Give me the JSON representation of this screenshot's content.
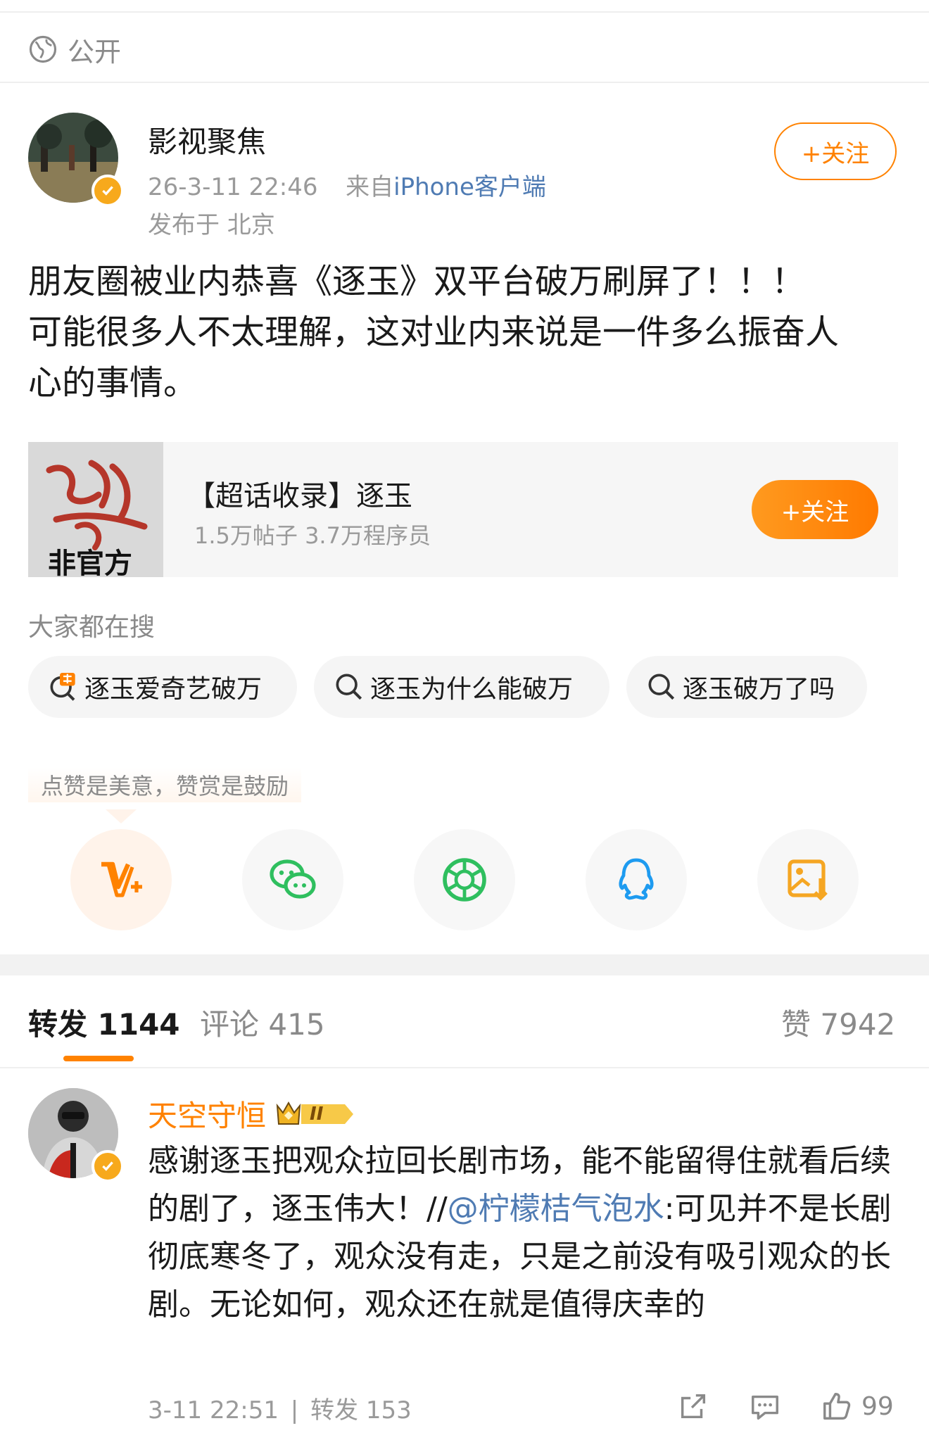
{
  "visibility": {
    "icon": "globe-icon",
    "label": "公开"
  },
  "post": {
    "author": "影视聚焦",
    "time": "26-3-11 22:46",
    "source_prefix": "来自",
    "source": "iPhone客户端",
    "location": "发布于 北京",
    "follow_label": "+关注",
    "text_lines": [
      "朋友圈被业内恭喜《逐玉》双平台破万刷屏了！！！",
      "可能很多人不太理解，这对业内来说是一件多么振奋人",
      "心的事情。"
    ]
  },
  "topic_card": {
    "thumb_text": "非官方",
    "title": "【超话收录】逐玉",
    "stats": "1.5万帖子 3.7万程序员",
    "follow_label": "+关注"
  },
  "search": {
    "heading": "大家都在搜",
    "chips": [
      {
        "label": "逐玉爱奇艺破万",
        "icon": "hot-search-icon"
      },
      {
        "label": "逐玉为什么能破万",
        "icon": "search-icon"
      },
      {
        "label": "逐玉破万了吗",
        "icon": "search-icon"
      }
    ]
  },
  "share": {
    "tip": "点赞是美意，赞赏是鼓励",
    "buttons": [
      {
        "icon": "v-plus-icon"
      },
      {
        "icon": "wechat-icon"
      },
      {
        "icon": "moments-icon"
      },
      {
        "icon": "qq-icon"
      },
      {
        "icon": "save-image-icon"
      }
    ]
  },
  "tabs": {
    "repost_label": "转发",
    "repost_count": "1144",
    "comment_label": "评论",
    "comment_count": "415",
    "like_label": "赞",
    "like_count": "7942"
  },
  "comment": {
    "user": "天空守恒",
    "level_badge": "II",
    "text_before": "感谢逐玉把观众拉回长剧市场，能不能留得住就看后续的剧了，逐玉伟大！//",
    "mention": "@柠檬桔气泡水",
    "text_after": ":可见并不是长剧彻底寒冬了，观众没有走，只是之前没有吸引观众的长剧。无论如何，观众还在就是值得庆幸的",
    "time": "3-11 22:51",
    "separator": "|",
    "repost_label": "转发",
    "repost_count": "153",
    "like_count": "99"
  },
  "colors": {
    "accent": "#ff8200",
    "link": "#4f7bb3",
    "muted": "#9a9a9a",
    "verified": "#f7a91c"
  }
}
